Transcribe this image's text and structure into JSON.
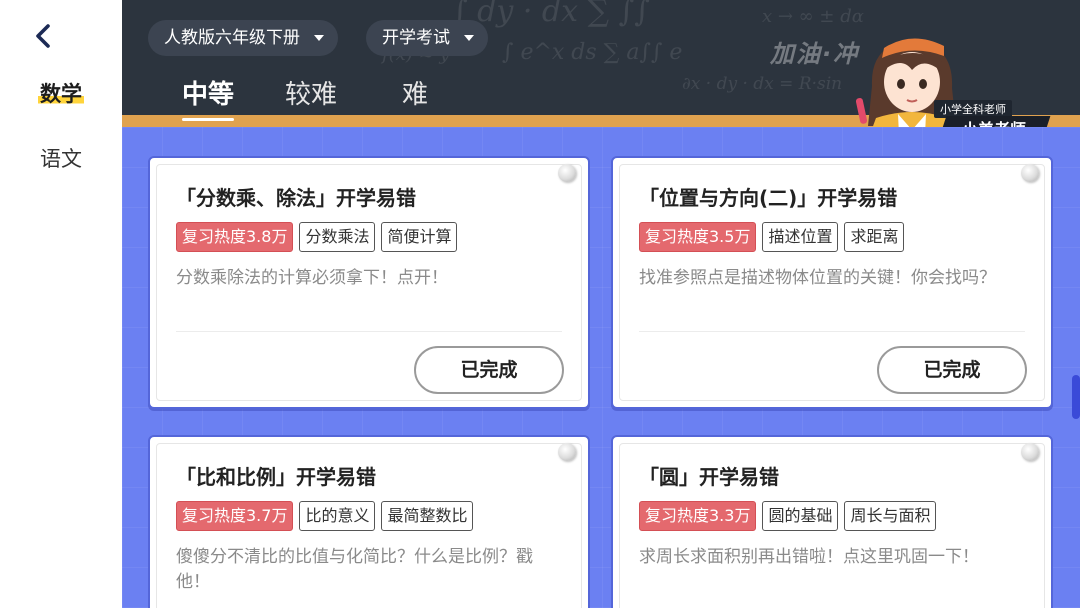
{
  "sidebar": {
    "items": [
      {
        "label": "数学",
        "active": true
      },
      {
        "label": "语文",
        "active": false
      }
    ]
  },
  "header": {
    "grade_dropdown": "人教版六年级下册",
    "exam_dropdown": "开学考试",
    "tabs": [
      {
        "label": "中等",
        "active": true
      },
      {
        "label": "较难",
        "active": false
      },
      {
        "label": "难",
        "active": false
      }
    ],
    "banner_text": "加油·冲",
    "teacher": {
      "subtitle": "小学全科老师",
      "name": "小美老师"
    }
  },
  "cards": [
    {
      "title": "「分数乘、除法」开学易错",
      "hot": "复习热度3.8万",
      "tags": [
        "分数乘法",
        "简便计算"
      ],
      "desc": "分数乘除法的计算必须拿下！点开！",
      "button": "已完成"
    },
    {
      "title": "「位置与方向(二)」开学易错",
      "hot": "复习热度3.5万",
      "tags": [
        "描述位置",
        "求距离"
      ],
      "desc": "找准参照点是描述物体位置的关键！你会找吗？",
      "button": "已完成"
    },
    {
      "title": "「比和比例」开学易错",
      "hot": "复习热度3.7万",
      "tags": [
        "比的意义",
        "最简整数比"
      ],
      "desc": "傻傻分不清比的比值与化简比？什么是比例？戳他！",
      "button": ""
    },
    {
      "title": "「圆」开学易错",
      "hot": "复习热度3.3万",
      "tags": [
        "圆的基础",
        "周长与面积"
      ],
      "desc": "求周长求面积别再出错啦！点这里巩固一下！",
      "button": ""
    }
  ],
  "colors": {
    "header_bg": "#2c343e",
    "main_bg": "#6b80f2",
    "hot_tag": "#e4696e",
    "accent_strip": "#e0a24f",
    "highlight": "#ffd43b"
  }
}
